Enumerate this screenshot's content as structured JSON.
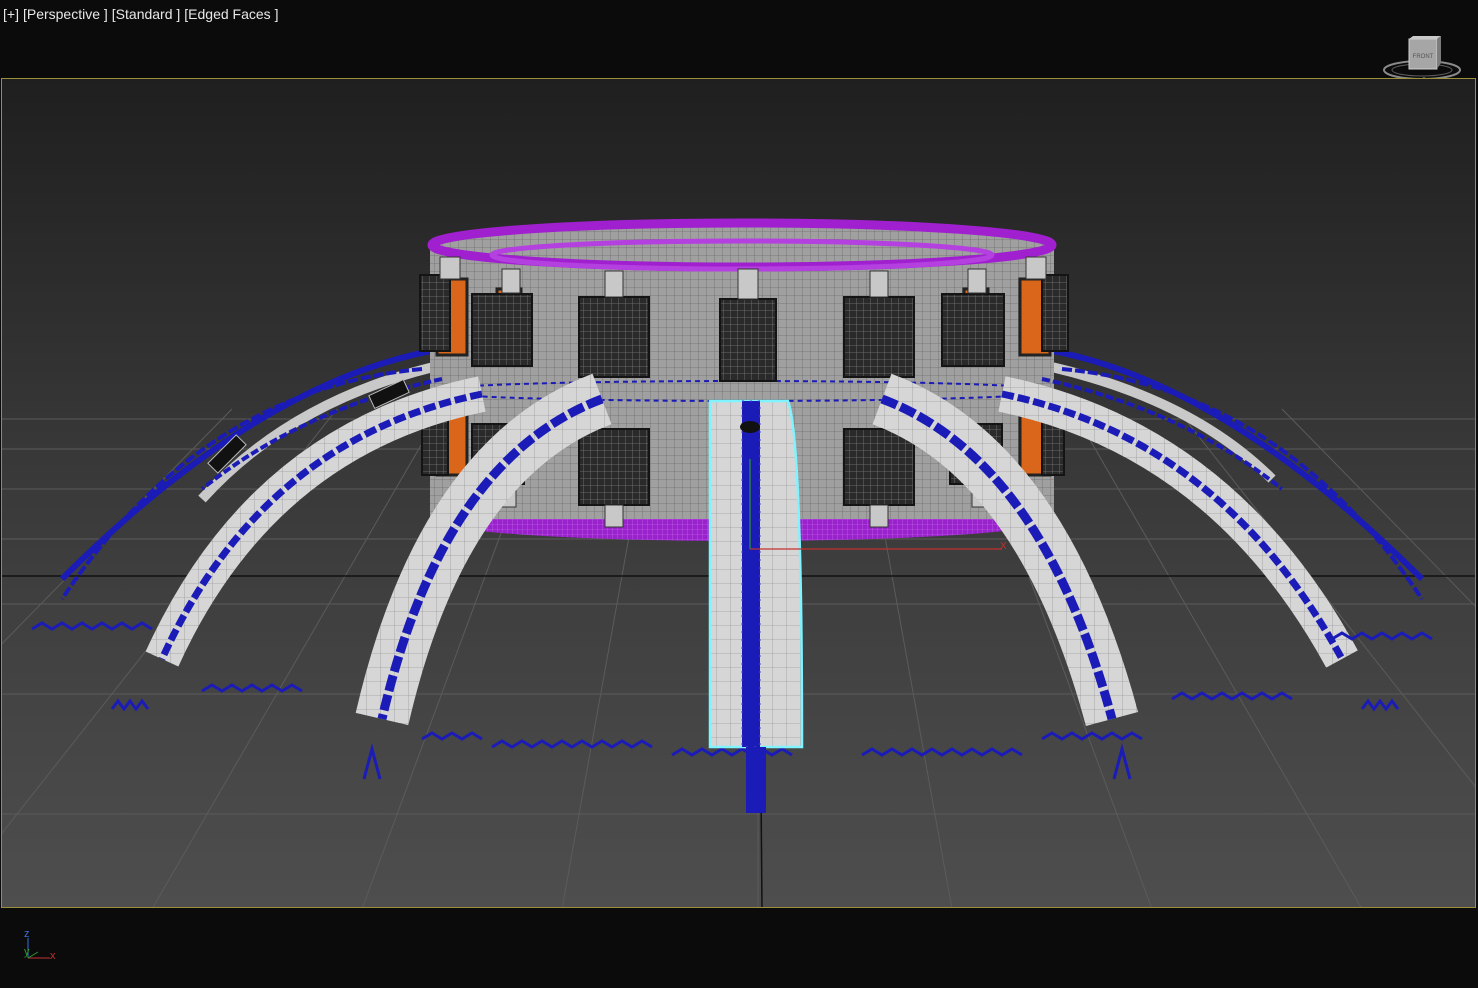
{
  "viewport": {
    "labels": [
      "[+]",
      "[Perspective ]",
      "[Standard ]",
      "[Edged Faces ]"
    ],
    "active_border_color": "#9c8f3a",
    "background_gradient": [
      "#1f1f1f",
      "#3a3a3a",
      "#4e4e4e"
    ]
  },
  "viewcube": {
    "face_label": "FRONT",
    "icon": "viewcube-icon"
  },
  "axis_tripod": {
    "z_label": "z",
    "y_label": "y",
    "x_label": "x"
  },
  "gizmo": {
    "x_label": "X"
  },
  "scene": {
    "colors": {
      "grid": "#5a5a5a",
      "wireframe_blue": "#1b1bb8",
      "ring_purple": "#a020d0",
      "drum_gray": "#9a9a9a",
      "accent_orange": "#d9661a",
      "selection_cyan": "#7ff3ff",
      "arch_white": "#d8d8d8"
    }
  }
}
